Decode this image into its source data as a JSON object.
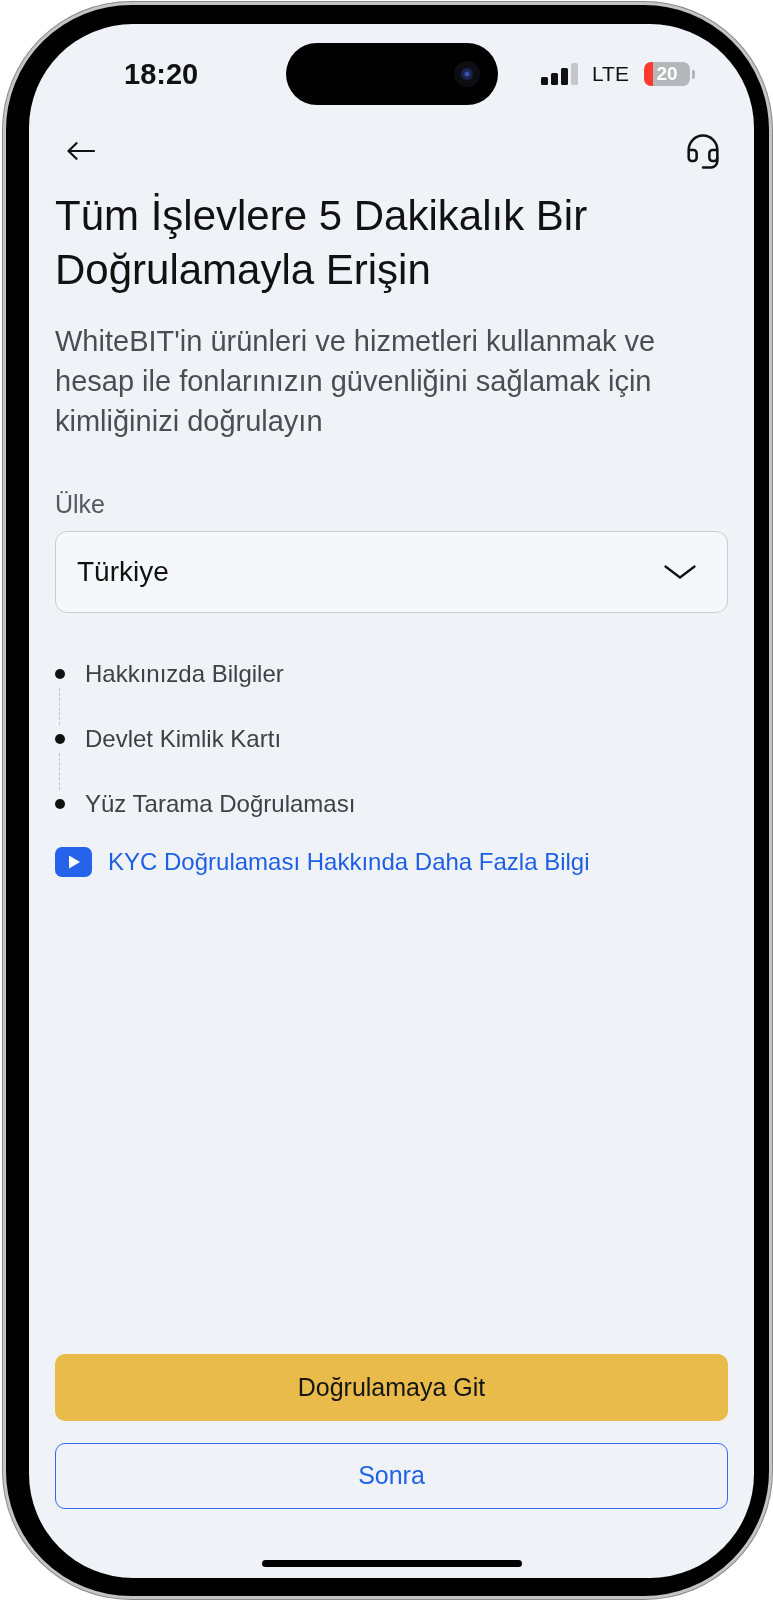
{
  "status_bar": {
    "time": "18:20",
    "network": "LTE",
    "battery": "20"
  },
  "title": "Tüm İşlevlere 5 Dakikalık Bir Doğrulamayla Erişin",
  "description": "WhiteBIT'in ürünleri ve hizmetleri kullanmak ve hesap ile fonlarınızın güvenliğini sağlamak için kimliğinizi doğrulayın",
  "country_field": {
    "label": "Ülke",
    "value": "Türkiye"
  },
  "steps": [
    "Hakkınızda Bilgiler",
    "Devlet Kimlik Kartı",
    "Yüz Tarama Doğrulaması"
  ],
  "video_link": {
    "label": "KYC Doğrulaması Hakkında Daha Fazla Bilgi"
  },
  "buttons": [
    {
      "label": "Doğrulamaya Git",
      "kind": "primary"
    },
    {
      "label": "Sonra",
      "kind": "secondary"
    }
  ]
}
